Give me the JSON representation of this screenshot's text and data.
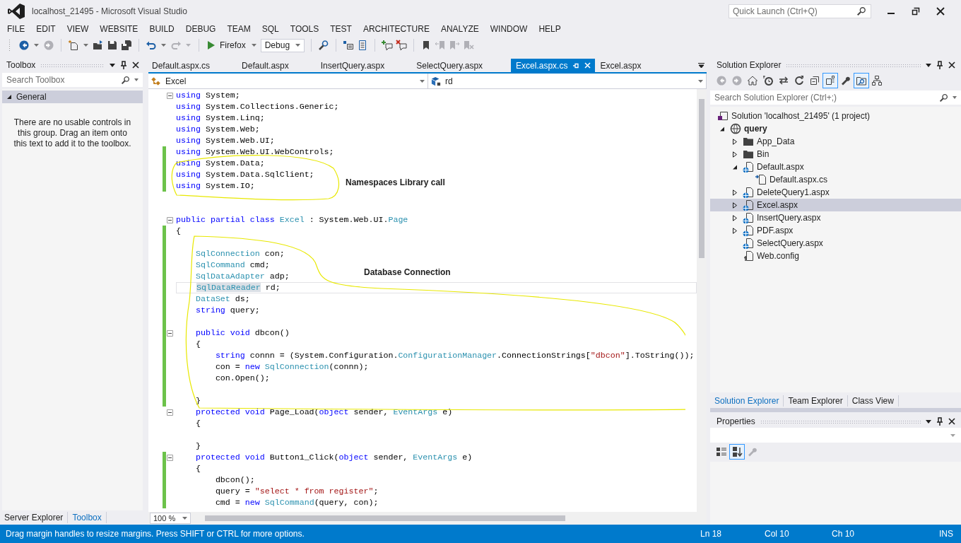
{
  "window": {
    "title": "localhost_21495 - Microsoft Visual Studio",
    "quick_launch": {
      "placeholder": "Quick Launch (Ctrl+Q)"
    }
  },
  "menu": [
    "FILE",
    "EDIT",
    "VIEW",
    "WEBSITE",
    "BUILD",
    "DEBUG",
    "TEAM",
    "SQL",
    "TOOLS",
    "TEST",
    "ARCHITECTURE",
    "ANALYZE",
    "WINDOW",
    "HELP"
  ],
  "toolbar": {
    "groups": [
      [
        {
          "kind": "back",
          "disabled": false,
          "dropdown": true
        },
        {
          "kind": "forward",
          "disabled": true,
          "dropdown": false
        }
      ],
      [
        {
          "kind": "new",
          "disabled": false,
          "dropdown": true
        },
        {
          "kind": "open",
          "disabled": false,
          "dropdown": false
        },
        {
          "kind": "save",
          "disabled": false,
          "dropdown": false
        },
        {
          "kind": "saveall",
          "disabled": false,
          "dropdown": false
        }
      ],
      [
        {
          "kind": "undo",
          "disabled": false,
          "dropdown": true
        },
        {
          "kind": "redo",
          "disabled": true,
          "dropdown": true
        }
      ],
      [
        {
          "kind": "run",
          "label": "Firefox",
          "disabled": false,
          "dropdown": true
        },
        {
          "kind": "combo",
          "value": "Debug",
          "disabled": false,
          "dropdown": false
        }
      ],
      [
        {
          "kind": "find",
          "disabled": false,
          "dropdown": false
        }
      ],
      [
        {
          "kind": "insertrow",
          "disabled": false,
          "dropdown": false
        },
        {
          "kind": "list",
          "disabled": false,
          "dropdown": false
        }
      ],
      [
        {
          "kind": "commentadd",
          "disabled": false,
          "dropdown": false
        },
        {
          "kind": "commentremove",
          "disabled": false,
          "dropdown": false
        }
      ],
      [
        {
          "kind": "bookmark",
          "disabled": false,
          "dropdown": false
        },
        {
          "kind": "bmprev",
          "disabled": true,
          "dropdown": false
        },
        {
          "kind": "bmnext",
          "disabled": true,
          "dropdown": false
        },
        {
          "kind": "bmclear",
          "disabled": true,
          "dropdown": false
        }
      ]
    ]
  },
  "toolbox": {
    "title": "Toolbox",
    "search": {
      "placeholder": "Search Toolbox"
    },
    "groups": [
      {
        "label": "General",
        "expanded": true,
        "selected": true
      }
    ],
    "empty_message": "There are no usable controls in this group. Drag an item onto this text to add it to the toolbox.",
    "tabs": [
      {
        "label": "Server Explorer",
        "selected": false
      },
      {
        "label": "Toolbox",
        "selected": true
      }
    ]
  },
  "editor": {
    "tabs": [
      {
        "label": "Default.aspx.cs",
        "selected": false
      },
      {
        "label": "Default.aspx",
        "selected": false
      },
      {
        "label": "InsertQuery.aspx",
        "selected": false
      },
      {
        "label": "SelectQuery.aspx",
        "selected": false
      },
      {
        "label": "Excel.aspx.cs",
        "selected": true
      },
      {
        "label": "Excel.aspx",
        "selected": false
      }
    ],
    "nav": [
      {
        "kind": "class",
        "value": "Excel"
      },
      {
        "kind": "field",
        "value": "rd"
      }
    ],
    "lines": [
      {
        "fold": true,
        "changed": false,
        "current": false,
        "tokens": [
          {
            "kind": "kw",
            "text": "using"
          },
          {
            "kind": "text",
            "text": " System;"
          }
        ]
      },
      {
        "fold": false,
        "changed": false,
        "current": false,
        "tokens": [
          {
            "kind": "kw",
            "text": "using"
          },
          {
            "kind": "text",
            "text": " System.Collections.Generic;"
          }
        ]
      },
      {
        "fold": false,
        "changed": false,
        "current": false,
        "tokens": [
          {
            "kind": "kw",
            "text": "using"
          },
          {
            "kind": "text",
            "text": " System.Linq;"
          }
        ]
      },
      {
        "fold": false,
        "changed": false,
        "current": false,
        "tokens": [
          {
            "kind": "kw",
            "text": "using"
          },
          {
            "kind": "text",
            "text": " System.Web;"
          }
        ]
      },
      {
        "fold": false,
        "changed": false,
        "current": false,
        "tokens": [
          {
            "kind": "kw",
            "text": "using"
          },
          {
            "kind": "text",
            "text": " System.Web.UI;"
          }
        ]
      },
      {
        "fold": false,
        "changed": true,
        "current": false,
        "tokens": [
          {
            "kind": "kw",
            "text": "using"
          },
          {
            "kind": "text",
            "text": " System.Web.UI.WebControls;"
          }
        ]
      },
      {
        "fold": false,
        "changed": true,
        "current": false,
        "tokens": [
          {
            "kind": "kw",
            "text": "using"
          },
          {
            "kind": "text",
            "text": " System.Data;"
          }
        ]
      },
      {
        "fold": false,
        "changed": true,
        "current": false,
        "tokens": [
          {
            "kind": "kw",
            "text": "using"
          },
          {
            "kind": "text",
            "text": " System.Data.SqlClient;"
          }
        ]
      },
      {
        "fold": false,
        "changed": true,
        "current": false,
        "tokens": [
          {
            "kind": "kw",
            "text": "using"
          },
          {
            "kind": "text",
            "text": " System.IO;"
          }
        ]
      },
      {
        "fold": false,
        "changed": false,
        "current": false
      },
      {
        "fold": false,
        "changed": false,
        "current": false
      },
      {
        "fold": true,
        "changed": false,
        "current": false,
        "tokens": [
          {
            "kind": "kw",
            "text": "public partial class "
          },
          {
            "kind": "type",
            "text": "Excel"
          },
          {
            "kind": "text",
            "text": " : System.Web.UI."
          },
          {
            "kind": "type",
            "text": "Page"
          }
        ]
      },
      {
        "fold": false,
        "changed": true,
        "current": false,
        "tokens": [
          {
            "kind": "text",
            "text": "{"
          }
        ]
      },
      {
        "fold": false,
        "changed": true,
        "current": false
      },
      {
        "fold": false,
        "changed": true,
        "current": false,
        "tokens": [
          {
            "kind": "type",
            "text": "    SqlConnection"
          },
          {
            "kind": "text",
            "text": " con;"
          }
        ]
      },
      {
        "fold": false,
        "changed": true,
        "current": false,
        "tokens": [
          {
            "kind": "type",
            "text": "    SqlCommand"
          },
          {
            "kind": "text",
            "text": " cmd;"
          }
        ]
      },
      {
        "fold": false,
        "changed": true,
        "current": false,
        "tokens": [
          {
            "kind": "type",
            "text": "    SqlDataAdapter"
          },
          {
            "kind": "text",
            "text": " adp;"
          }
        ]
      },
      {
        "fold": false,
        "changed": true,
        "current": true,
        "tokens": [
          {
            "kind": "ref",
            "text": "    SqlDataReader"
          },
          {
            "kind": "text",
            "text": " rd;"
          }
        ]
      },
      {
        "fold": false,
        "changed": true,
        "current": false,
        "tokens": [
          {
            "kind": "type",
            "text": "    DataSet"
          },
          {
            "kind": "text",
            "text": " ds;"
          }
        ]
      },
      {
        "fold": false,
        "changed": true,
        "current": false,
        "tokens": [
          {
            "kind": "kw",
            "text": "    string"
          },
          {
            "kind": "text",
            "text": " query;"
          }
        ]
      },
      {
        "fold": false,
        "changed": true,
        "current": false
      },
      {
        "fold": true,
        "changed": true,
        "current": false,
        "tokens": [
          {
            "kind": "kw",
            "text": "    public void"
          },
          {
            "kind": "text",
            "text": " dbcon()"
          }
        ]
      },
      {
        "fold": false,
        "changed": true,
        "current": false,
        "tokens": [
          {
            "kind": "text",
            "text": "    {"
          }
        ]
      },
      {
        "fold": false,
        "changed": true,
        "current": false,
        "tokens": [
          {
            "kind": "kw",
            "text": "        string"
          },
          {
            "kind": "text",
            "text": " connn = (System.Configuration."
          },
          {
            "kind": "type",
            "text": "ConfigurationManager"
          },
          {
            "kind": "text",
            "text": ".ConnectionStrings["
          },
          {
            "kind": "str",
            "text": "\"dbcon\""
          },
          {
            "kind": "text",
            "text": "].ToString());"
          }
        ]
      },
      {
        "fold": false,
        "changed": true,
        "current": false,
        "tokens": [
          {
            "kind": "text",
            "text": "        con = "
          },
          {
            "kind": "kw",
            "text": "new "
          },
          {
            "kind": "type",
            "text": "SqlConnection"
          },
          {
            "kind": "text",
            "text": "(connn);"
          }
        ]
      },
      {
        "fold": false,
        "changed": true,
        "current": false,
        "tokens": [
          {
            "kind": "text",
            "text": "        con.Open();"
          }
        ]
      },
      {
        "fold": false,
        "changed": true,
        "current": false
      },
      {
        "fold": false,
        "changed": true,
        "current": false,
        "tokens": [
          {
            "kind": "text",
            "text": "    }"
          }
        ]
      },
      {
        "fold": true,
        "changed": false,
        "current": false,
        "tokens": [
          {
            "kind": "kw",
            "text": "    protected void"
          },
          {
            "kind": "text",
            "text": " Page_Load("
          },
          {
            "kind": "kw",
            "text": "object"
          },
          {
            "kind": "text",
            "text": " sender, "
          },
          {
            "kind": "type",
            "text": "EventArgs"
          },
          {
            "kind": "text",
            "text": " e)"
          }
        ]
      },
      {
        "fold": false,
        "changed": false,
        "current": false,
        "tokens": [
          {
            "kind": "text",
            "text": "    {"
          }
        ]
      },
      {
        "fold": false,
        "changed": false,
        "current": false
      },
      {
        "fold": false,
        "changed": false,
        "current": false,
        "tokens": [
          {
            "kind": "text",
            "text": "    }"
          }
        ]
      },
      {
        "fold": true,
        "changed": true,
        "current": false,
        "tokens": [
          {
            "kind": "kw",
            "text": "    protected void"
          },
          {
            "kind": "text",
            "text": " Button1_Click("
          },
          {
            "kind": "kw",
            "text": "object"
          },
          {
            "kind": "text",
            "text": " sender, "
          },
          {
            "kind": "type",
            "text": "EventArgs"
          },
          {
            "kind": "text",
            "text": " e)"
          }
        ]
      },
      {
        "fold": false,
        "changed": true,
        "current": false,
        "tokens": [
          {
            "kind": "text",
            "text": "    {"
          }
        ]
      },
      {
        "fold": false,
        "changed": true,
        "current": false,
        "tokens": [
          {
            "kind": "text",
            "text": "        dbcon();"
          }
        ]
      },
      {
        "fold": false,
        "changed": true,
        "current": false,
        "tokens": [
          {
            "kind": "text",
            "text": "        query = "
          },
          {
            "kind": "str",
            "text": "\"select * from register\""
          },
          {
            "kind": "text",
            "text": ";"
          }
        ]
      },
      {
        "fold": false,
        "changed": true,
        "current": false,
        "tokens": [
          {
            "kind": "text",
            "text": "        cmd = "
          },
          {
            "kind": "kw",
            "text": "new "
          },
          {
            "kind": "type",
            "text": "SqlCommand"
          },
          {
            "kind": "text",
            "text": "(query, con);"
          }
        ]
      }
    ],
    "annotations": [
      {
        "text": "Namespaces  Library call"
      },
      {
        "text": "Database Connection"
      }
    ],
    "zoom": "100 %"
  },
  "solution_explorer": {
    "title": "Solution Explorer",
    "toolbar": [
      {
        "kind": "back",
        "disabled": true,
        "on": false
      },
      {
        "kind": "forward",
        "disabled": true,
        "on": false
      },
      {
        "kind": "home",
        "disabled": false,
        "on": false
      },
      {
        "kind": "pending",
        "disabled": false,
        "on": false
      },
      {
        "kind": "sync",
        "disabled": false,
        "on": false
      },
      {
        "kind": "refresh",
        "disabled": false,
        "on": false
      },
      {
        "kind": "collapse",
        "disabled": false,
        "on": false
      },
      {
        "kind": "showall",
        "disabled": false,
        "on": true
      },
      {
        "kind": "wrench",
        "disabled": false,
        "on": false
      },
      {
        "kind": "preview",
        "disabled": false,
        "on": true
      },
      {
        "kind": "classdiagram",
        "disabled": false,
        "on": false
      }
    ],
    "search": {
      "placeholder": "Search Solution Explorer (Ctrl+;)"
    },
    "tree": [
      {
        "label": "Solution 'localhost_21495' (1 project)",
        "kind": "solution",
        "selected": false,
        "children": [
          {
            "label": "query",
            "kind": "project",
            "expanded": true,
            "selected": false,
            "children": [
              {
                "label": "App_Data",
                "kind": "folder",
                "expanded": false,
                "selected": false
              },
              {
                "label": "Bin",
                "kind": "folder",
                "expanded": false,
                "selected": false
              },
              {
                "label": "Default.aspx",
                "kind": "page",
                "expanded": true,
                "selected": false,
                "children": [
                  {
                    "label": "Default.aspx.cs",
                    "kind": "code",
                    "selected": false
                  }
                ]
              },
              {
                "label": "DeleteQuery1.aspx",
                "kind": "page",
                "expanded": false,
                "selected": false
              },
              {
                "label": "Excel.aspx",
                "kind": "page",
                "expanded": false,
                "selected": true
              },
              {
                "label": "InsertQuery.aspx",
                "kind": "page",
                "expanded": false,
                "selected": false
              },
              {
                "label": "PDF.aspx",
                "kind": "page",
                "expanded": false,
                "selected": false
              },
              {
                "label": "SelectQuery.aspx",
                "kind": "page",
                "selected": false
              },
              {
                "label": "Web.config",
                "kind": "config",
                "selected": false
              }
            ]
          }
        ]
      }
    ],
    "tabs": [
      {
        "label": "Solution Explorer",
        "selected": true
      },
      {
        "label": "Team Explorer",
        "selected": false
      },
      {
        "label": "Class View",
        "selected": false
      }
    ]
  },
  "properties": {
    "title": "Properties",
    "toolbar": [
      {
        "kind": "categorized",
        "disabled": false,
        "on": false
      },
      {
        "kind": "alphabetical",
        "disabled": false,
        "on": true
      },
      {
        "kind": "wrench",
        "disabled": true,
        "on": false
      }
    ]
  },
  "status_bar": {
    "message": "Drag margin handles to resize margins. Press SHIFT or CTRL for more options.",
    "line": "Ln 18",
    "column": "Col 10",
    "char": "Ch 10",
    "mode": "INS"
  }
}
